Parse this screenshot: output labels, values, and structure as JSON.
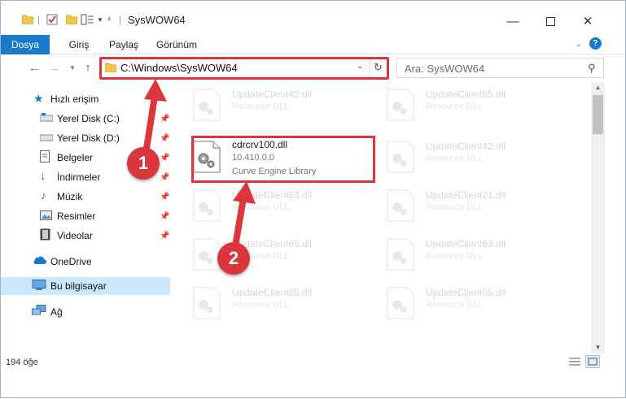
{
  "window": {
    "title": "SysWOW64"
  },
  "ribbon": {
    "tabs": [
      "Dosya",
      "Giriş",
      "Paylaş",
      "Görünüm"
    ]
  },
  "address": {
    "path": "C:\\Windows\\SysWOW64"
  },
  "search": {
    "placeholder": "Ara: SysWOW64"
  },
  "sidebar": {
    "quick_access": "Hızlı erişim",
    "items": [
      "Yerel Disk (C:)",
      "Yerel Disk (D:)",
      "Belgeler",
      "İndirmeler",
      "Müzik",
      "Resimler",
      "Videolar"
    ],
    "onedrive": "OneDrive",
    "this_pc": "Bu bilgisayar",
    "network": "Ağ"
  },
  "files": {
    "selected": {
      "name": "cdrcrv100.dll",
      "version": "10.410.0.0",
      "description": "Curve Engine Library"
    },
    "others": [
      {
        "name": "UpdateClient42.dll",
        "desc": "Resource DLL"
      },
      {
        "name": "UpdateClient65.dll",
        "desc": "Resource DLL"
      },
      {
        "name": "UpdateClient42.dll",
        "desc": "Resource DLL"
      },
      {
        "name": "UpdateClient63.dll",
        "desc": "Resource DLL"
      },
      {
        "name": "UpdateClient21.dll",
        "desc": "Resource DLL"
      },
      {
        "name": "UpdateClient65.dll",
        "desc": "Resource DLL"
      },
      {
        "name": "UpdateClient63.dll",
        "desc": "Resource DLL"
      },
      {
        "name": "UpdateClient65.dll",
        "desc": "Resource DLL"
      },
      {
        "name": "UpdateClient65.dll",
        "desc": "Resource DLL"
      }
    ]
  },
  "status": {
    "count": "194 öğe"
  },
  "annotations": {
    "step1": "1",
    "step2": "2",
    "color": "#d9363e"
  }
}
